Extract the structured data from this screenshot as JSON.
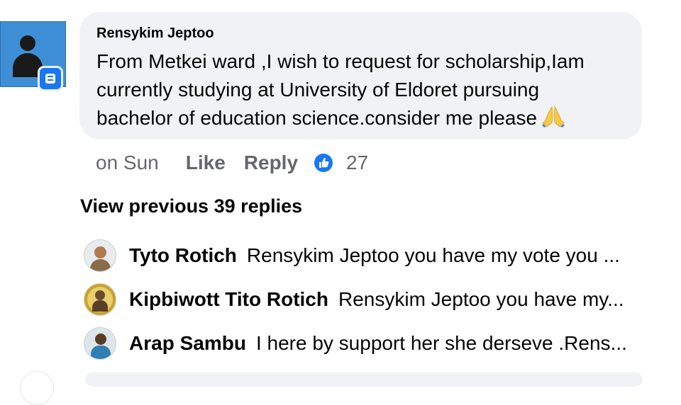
{
  "comment": {
    "author": "Rensykim Jeptoo",
    "lines": [
      "From Metkei ward ,I wish to request for scholarship,Iam",
      "currently studying at University of Eldoret pursuing",
      "bachelor of education science.consider me please"
    ],
    "emoji_icon": "folded-hands-icon"
  },
  "actions": {
    "time": "on Sun",
    "like_label": "Like",
    "reply_label": "Reply",
    "reaction_icon": "thumbs-up-icon",
    "reaction_count": "27"
  },
  "view_previous": "View previous 39 replies",
  "replies": [
    {
      "name": "Tyto Rotich",
      "text": "Rensykim Jeptoo  you have my vote you ..."
    },
    {
      "name": "Kipbiwott Tito Rotich",
      "text": "Rensykim Jeptoo  you have my..."
    },
    {
      "name": "Arap Sambu",
      "text": "I here by support her she derseve .Rens..."
    }
  ],
  "colors": {
    "bubble": "#f0f2f5",
    "muted_text": "#65676b",
    "accent": "#1877f2"
  }
}
